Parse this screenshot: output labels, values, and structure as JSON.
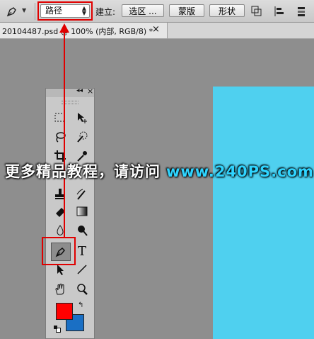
{
  "options_bar": {
    "tool_icon": "pen-icon",
    "mode_value": "路径",
    "make_label": "建立:",
    "selection_button": "选区 ...",
    "mask_button": "蒙版",
    "shape_button": "形状",
    "icons": [
      "path-operations-icon",
      "path-alignment-icon",
      "path-arrangement-icon"
    ]
  },
  "document_tab": {
    "title": "20104487.psd @ 100% (内部, RGB/8) *",
    "close": "×"
  },
  "toolbox": {
    "collapse_glyph": "◂◂",
    "close_glyph": "×",
    "active_tool": "pen-tool",
    "foreground_color": "#ff0000",
    "background_color": "#1a6fc4"
  },
  "document": {
    "canvas_color": "#4fd0ef"
  },
  "watermark": {
    "text": "更多精品教程，请访问",
    "url": "www.240PS.com"
  },
  "highlight_color": "#e00000"
}
